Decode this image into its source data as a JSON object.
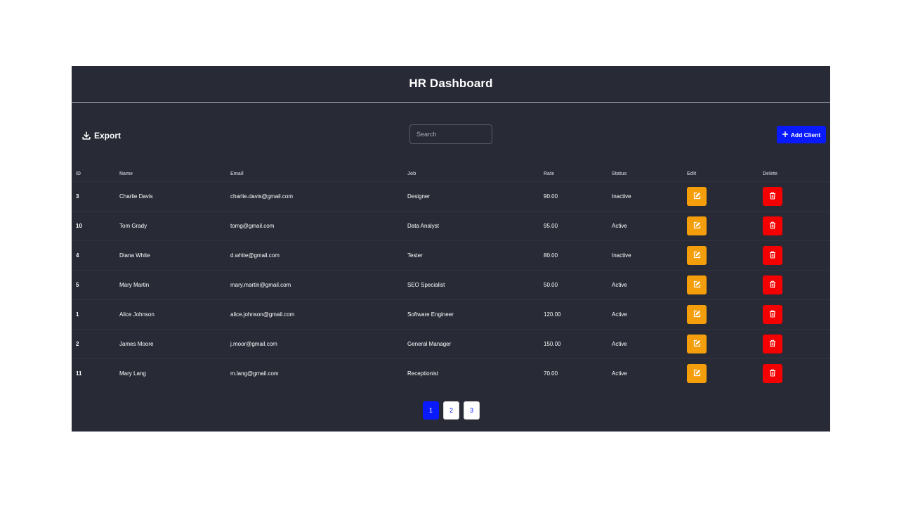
{
  "header": {
    "title": "HR Dashboard"
  },
  "toolbar": {
    "export_label": "Export",
    "export_icon": "download-icon",
    "search_placeholder": "Search",
    "search_value": "",
    "add_label": "Add Client",
    "add_icon": "plus-icon"
  },
  "table": {
    "columns": [
      "ID",
      "Name",
      "Email",
      "Job",
      "Rate",
      "Status",
      "Edit",
      "Delete"
    ],
    "rows": [
      {
        "id": "3",
        "name": "Charlie Davis",
        "email": "charlie.davis@gmail.com",
        "job": "Designer",
        "rate": "90.00",
        "status": "Inactive"
      },
      {
        "id": "10",
        "name": "Tom Grady",
        "email": "tomg@gmail.com",
        "job": "Data Analyst",
        "rate": "95.00",
        "status": "Active"
      },
      {
        "id": "4",
        "name": "Diana White",
        "email": "d.white@gmail.com",
        "job": "Tester",
        "rate": "80.00",
        "status": "Inactive"
      },
      {
        "id": "5",
        "name": "Mary Martin",
        "email": "mary.martin@gmail.com",
        "job": "SEO Specialist",
        "rate": "50.00",
        "status": "Active"
      },
      {
        "id": "1",
        "name": "Alice Johnson",
        "email": "alice.johnson@gmail.com",
        "job": "Software Engineer",
        "rate": "120.00",
        "status": "Active"
      },
      {
        "id": "2",
        "name": "James Moore",
        "email": "j.moor@gmail.com",
        "job": "General Manager",
        "rate": "150.00",
        "status": "Active"
      },
      {
        "id": "11",
        "name": "Mary Lang",
        "email": "m.lang@gmail.com",
        "job": "Receptionist",
        "rate": "70.00",
        "status": "Active"
      }
    ],
    "edit_icon": "edit-icon",
    "delete_icon": "trash-icon"
  },
  "pagination": {
    "pages": [
      "1",
      "2",
      "3"
    ],
    "current": "1"
  },
  "colors": {
    "panel_bg": "#282a36",
    "accent": "#0a1aff",
    "edit": "#f59e0b",
    "delete": "#f50000",
    "active": "#4ade80",
    "inactive": "#facc15"
  }
}
